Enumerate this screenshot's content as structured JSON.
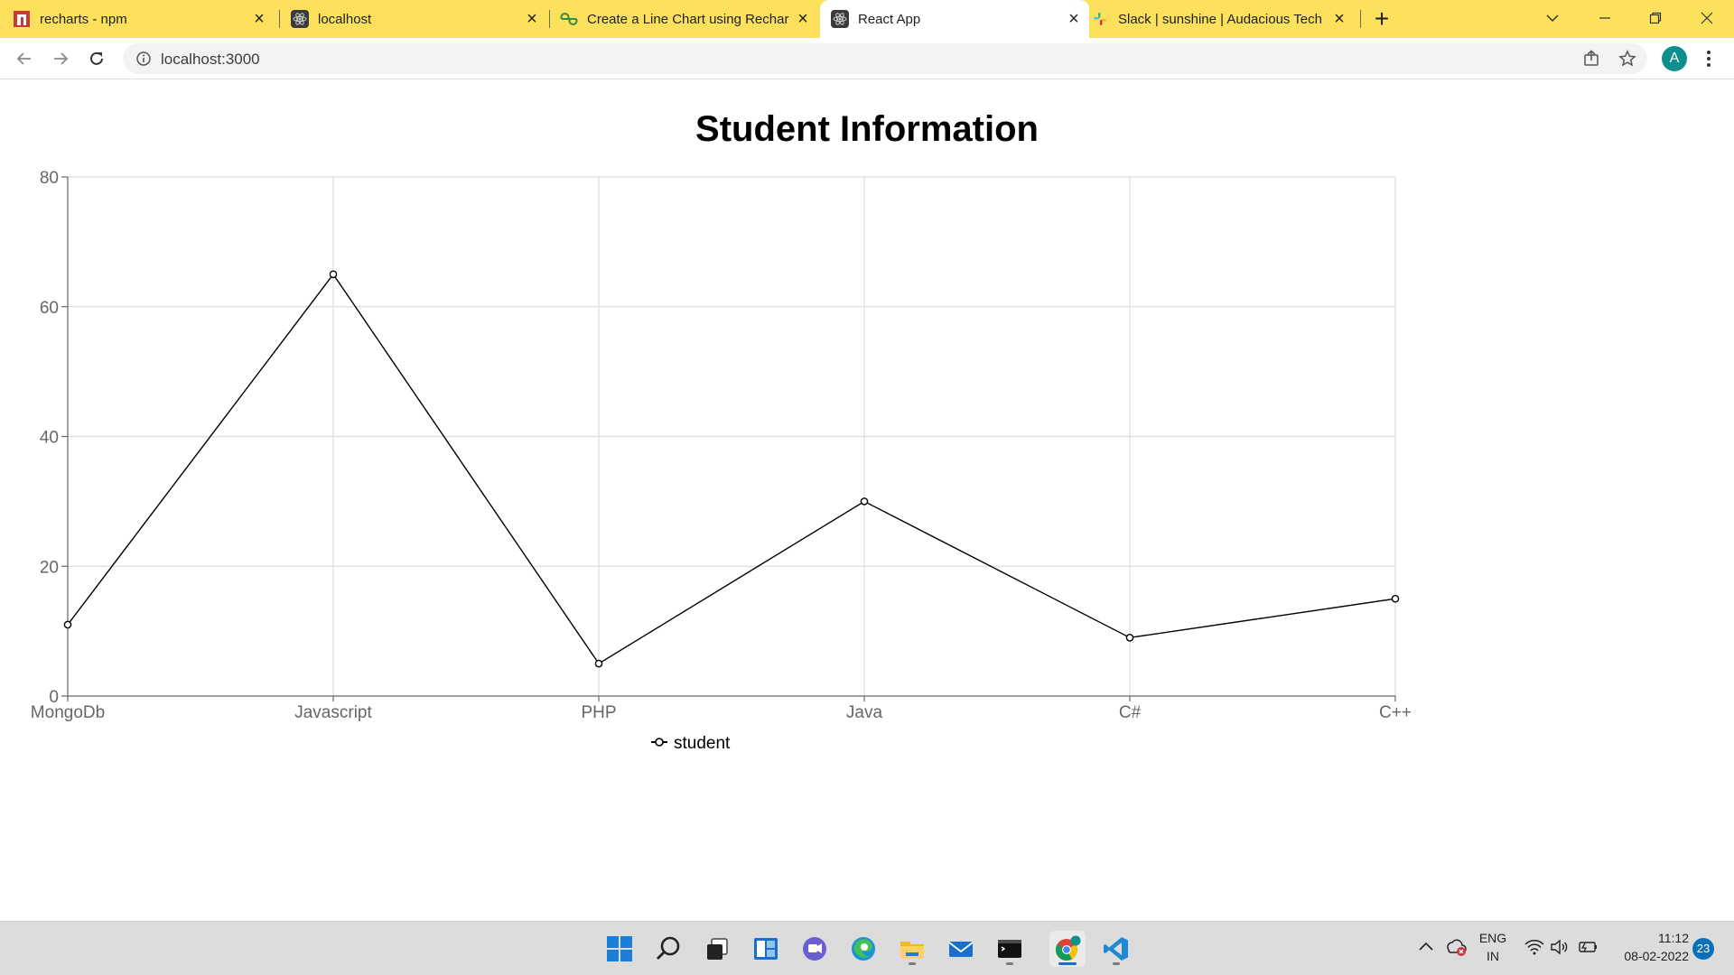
{
  "browser": {
    "tabs": [
      {
        "title": "recharts - npm",
        "favicon": "npm-icon",
        "active": false
      },
      {
        "title": "localhost",
        "favicon": "react-icon",
        "active": false
      },
      {
        "title": "Create a Line Chart using Rechar",
        "favicon": "geeksforgeeks-icon",
        "active": false
      },
      {
        "title": "React App",
        "favicon": "react-icon",
        "active": true
      },
      {
        "title": "Slack | sunshine | Audacious Tech",
        "favicon": "slack-icon",
        "active": false
      }
    ],
    "new_tab_label": "+",
    "url": "localhost:3000",
    "avatar_letter": "A"
  },
  "page": {
    "title": "Student Information"
  },
  "chart_data": {
    "type": "line",
    "title": "Student Information",
    "categories": [
      "MongoDb",
      "Javascript",
      "PHP",
      "Java",
      "C#",
      "C++"
    ],
    "series": [
      {
        "name": "student",
        "values": [
          11,
          65,
          5,
          30,
          9,
          15
        ],
        "color": "#000000"
      }
    ],
    "ylim": [
      0,
      80
    ],
    "yticks": [
      0,
      20,
      40,
      60,
      80
    ],
    "grid": true,
    "legend_position": "bottom"
  },
  "taskbar": {
    "language": "ENG",
    "region": "IN",
    "time": "11:12",
    "date": "08-02-2022",
    "notifications": "23"
  }
}
